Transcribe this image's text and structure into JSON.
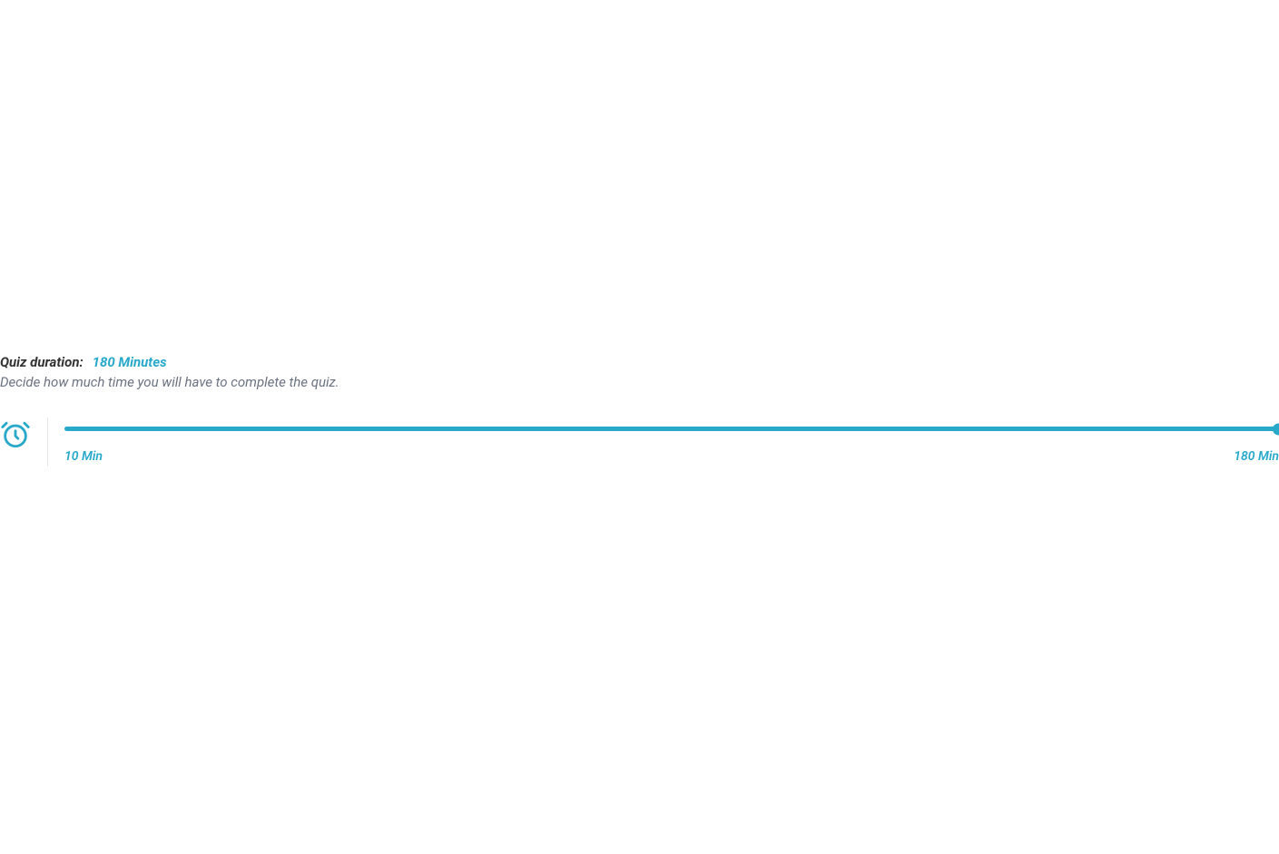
{
  "duration": {
    "label": "Quiz duration:",
    "value": "180 Minutes",
    "description": "Decide how much time you will have to complete the quiz.",
    "slider": {
      "min_label": "10 Min",
      "max_label": "180 Min",
      "min": 10,
      "max": 180,
      "current": 180
    }
  },
  "colors": {
    "accent": "#28a9c9"
  }
}
